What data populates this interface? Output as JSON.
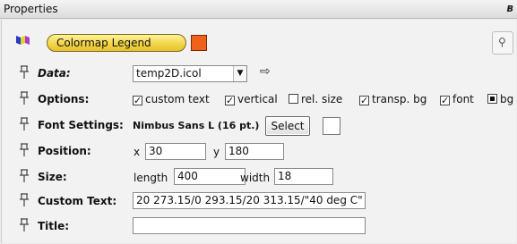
{
  "panel": {
    "title": "Properties",
    "pin_glyph": "ʙ"
  },
  "object": {
    "name": "Colormap Legend",
    "color": "#f0621a",
    "type_icon": "colormap-legend-icon",
    "side_button_glyph": "⚲"
  },
  "rows": {
    "data": {
      "label": "Data:",
      "value": "temp2D.icol",
      "arrow": "▼",
      "goto": "⇨"
    },
    "options": {
      "label": "Options:",
      "items": [
        {
          "label": "custom text",
          "checked": true
        },
        {
          "label": "vertical",
          "checked": true
        },
        {
          "label": "rel. size",
          "checked": false
        },
        {
          "label": "transp. bg",
          "checked": true
        },
        {
          "label": "font",
          "checked": true
        },
        {
          "label": "bg",
          "checked": true
        }
      ]
    },
    "font": {
      "label": "Font Settings:",
      "value": "Nimbus Sans L (16 pt.)",
      "button": "Select"
    },
    "position": {
      "label": "Position:",
      "x_label": "x",
      "x": "30",
      "y_label": "y",
      "y": "180"
    },
    "size": {
      "label": "Size:",
      "length_label": "length",
      "length": "400",
      "width_label": "width",
      "width": "18"
    },
    "custom_text": {
      "label": "Custom Text:",
      "value": "20 273.15/0 293.15/20 313.15/\"40 deg C\""
    },
    "title": {
      "label": "Title:",
      "value": ""
    }
  }
}
